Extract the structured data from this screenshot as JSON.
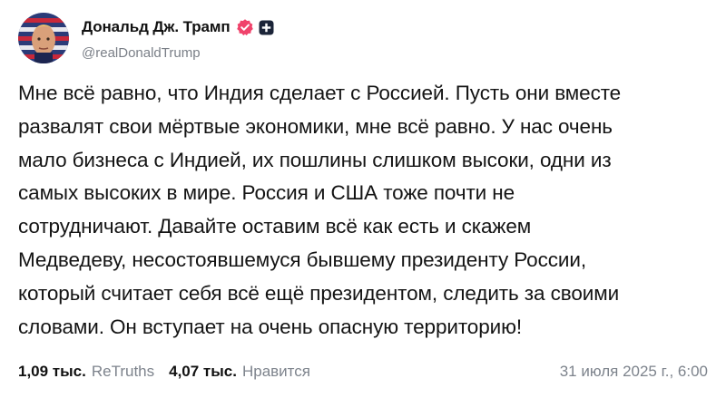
{
  "author": {
    "display_name": "Дональд Дж. Трамп",
    "handle": "@realDonaldTrump",
    "verified_icon": "verified-badge-icon",
    "extra_icon": "square-plus-icon",
    "verified_color": "#f0436b"
  },
  "post": {
    "text": "Мне всё равно, что Индия сделает с Россией. Пусть они вместе\nразвалят свои мёртвые экономики, мне всё равно. У нас очень\nмало бизнеса с Индией, их пошлины слишком высоки, одни из\nсамых высоких в мире. Россия и США тоже почти не\nсотрудничают. Давайте оставим всё как есть и скажем\nМедведеву, несостоявшемуся бывшему президенту России,\nкоторый считает себя всё ещё президентом, следить за своими\nсловами. Он вступает на очень опасную территорию!"
  },
  "stats": {
    "retruths_count": "1,09 тыс.",
    "retruths_label": "ReTruths",
    "likes_count": "4,07 тыс.",
    "likes_label": "Нравится",
    "timestamp": "31 июля 2025 г., 6:00"
  }
}
